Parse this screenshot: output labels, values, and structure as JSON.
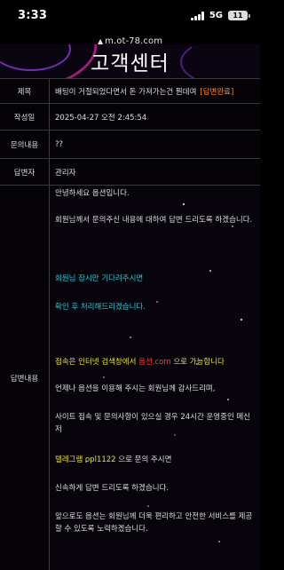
{
  "status_bar": {
    "time": "3:33",
    "network": "5G",
    "battery": "11"
  },
  "browser": {
    "url": "m.ot-78.com"
  },
  "header": {
    "title": "고객센터"
  },
  "details": {
    "subject_label": "제목",
    "subject_value": "배팅이 거절되었다면서 돈 가져가는건 뭔데여",
    "subject_status": "[답변완료]",
    "date_label": "작성일",
    "date_value": "2025-04-27 오전 2:45:54",
    "inquiry_label": "문의내용",
    "inquiry_value": "??",
    "responder_label": "답변자",
    "responder_value": "관리자",
    "answer_label": "답변내용"
  },
  "answer": {
    "p1": "안녕하세요 옵션입니다.",
    "p2": "회원님께서 문의주신 내용에 대하여 답변 드리도록 하겠습니다.",
    "p3": "회원님 잠시만 기다려주시면",
    "p4": "확인 후 처리해드리겠습니다.",
    "p5_a": "접속은 인터넷 검색창에서 ",
    "p5_b": "옵션.com",
    "p5_c": " 으로 가능합니다",
    "p6": "언제나 옵션을 이용해 주시는 회원님께 감사드리며,",
    "p7": "사이트 접속 및 문의사항이 있으실 경우 24시간 운영중인 메신저",
    "p8_a": "텔레그램 opl1122",
    "p8_b": " 으로 문의 주시면",
    "p9": "신속하게 답변 드리도록 하겠습니다.",
    "p10": "앞으로도 옵션는 회원님께 더욱 편리하고 안전한 서비스를 제공할 수 있도록 노력하겠습니다."
  },
  "colors": {
    "highlight_cyan": "#25c7d3",
    "highlight_yellow": "#e8e12b",
    "highlight_red": "#ff3b3b",
    "status_orange": "#ff8a2a"
  }
}
